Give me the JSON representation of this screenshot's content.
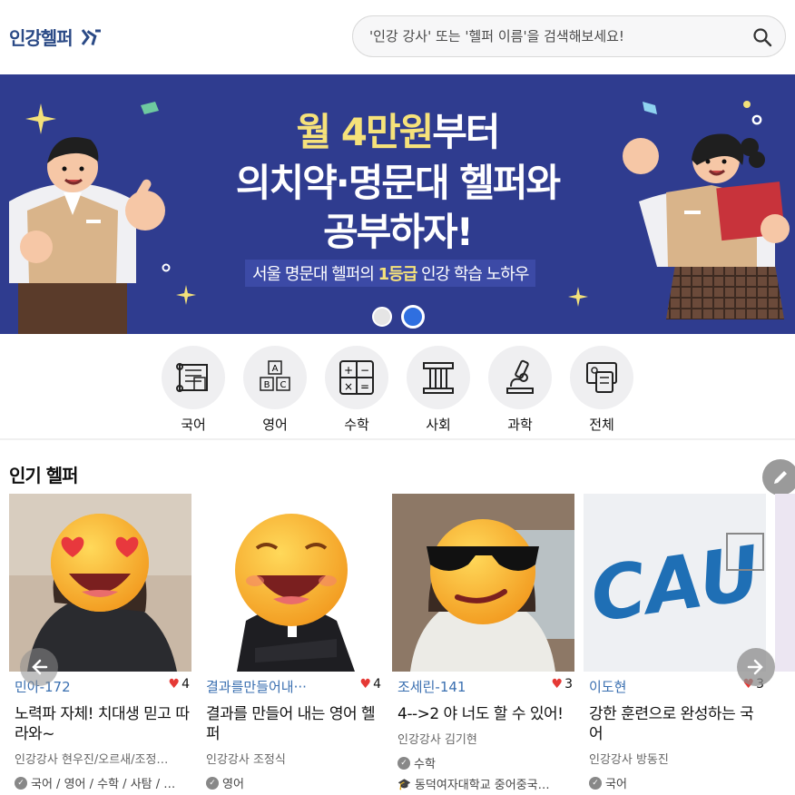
{
  "header": {
    "logo_text": "인강헬퍼",
    "search_placeholder": "'인강 강사' 또는 '헬퍼 이름'을 검색해보세요!"
  },
  "banner": {
    "line1_accent": "월 4만원",
    "line1_rest": "부터",
    "line2": "의치약·명문대 헬퍼와",
    "line3": "공부하자!",
    "sub_prefix": "서울 명문대 헬퍼의 ",
    "sub_accent": "1등급",
    "sub_suffix": " 인강 학습 노하우",
    "slides_total": 2,
    "active_slide": 2,
    "colors": {
      "background": "#2f3c8f",
      "accent": "#f6e27a"
    }
  },
  "categories": [
    {
      "label": "국어",
      "icon": "book-scroll-icon"
    },
    {
      "label": "영어",
      "icon": "abc-blocks-icon"
    },
    {
      "label": "수학",
      "icon": "math-operators-icon"
    },
    {
      "label": "사회",
      "icon": "pillar-building-icon"
    },
    {
      "label": "과학",
      "icon": "microscope-icon"
    },
    {
      "label": "전체",
      "icon": "all-devices-icon"
    }
  ],
  "popular": {
    "title": "인기 헬퍼",
    "cards": [
      {
        "name": "민아-172",
        "likes": "4",
        "title": "노력파 자체! 치대생 믿고 따라와~",
        "teacher": "인강강사  현우진/오르새/조정…",
        "tag": "국어 / 영어 / 수학 / 사탐 / …",
        "tag2": ""
      },
      {
        "name": "결과를만들어내···",
        "likes": "4",
        "title": "결과를 만들어 내는 영어 헬퍼",
        "teacher": "인강강사  조정식",
        "tag": "영어",
        "tag2": ""
      },
      {
        "name": "조세린-141",
        "likes": "3",
        "title": "4-->2 야 너도 할 수 있어!",
        "teacher": "인강강사  김기현",
        "tag": "수학",
        "tag2": "동덕여자대학교 중어중국…"
      },
      {
        "name": "이도현",
        "likes": "3",
        "title": "강한 훈련으로 완성하는 국어",
        "teacher": "인강강사  방동진",
        "tag": "국어",
        "tag2": ""
      }
    ]
  },
  "colors": {
    "brand": "#2b4a86",
    "name_link": "#3a6fb0",
    "heart": "#e53935"
  }
}
